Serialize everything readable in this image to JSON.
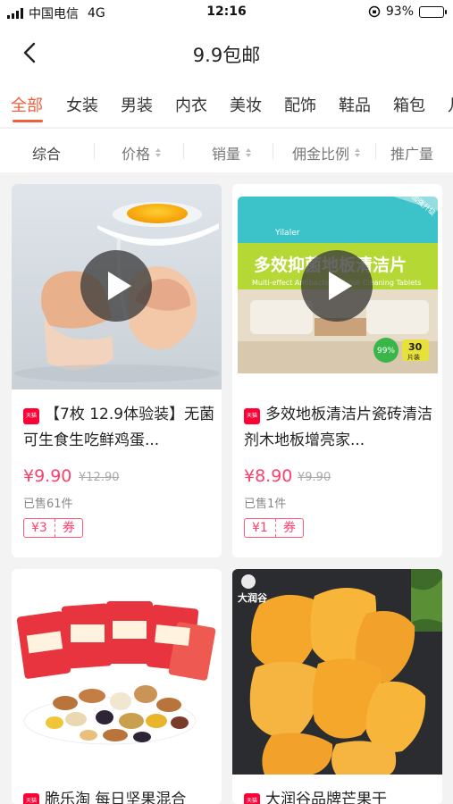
{
  "status_bar": {
    "carrier": "中国电信",
    "network": "4G",
    "time": "12:16",
    "battery": "93%",
    "battery_level": 0.93
  },
  "nav": {
    "title": "9.9包邮",
    "back_icon": "chevron-left-icon"
  },
  "tabs": [
    {
      "label": "全部",
      "active": true
    },
    {
      "label": "女装"
    },
    {
      "label": "男装"
    },
    {
      "label": "内衣"
    },
    {
      "label": "美妆"
    },
    {
      "label": "配饰"
    },
    {
      "label": "鞋品"
    },
    {
      "label": "箱包"
    },
    {
      "label": "儿"
    }
  ],
  "sort": [
    {
      "label": "综合"
    },
    {
      "label": "价格"
    },
    {
      "label": "销量"
    },
    {
      "label": "佣金比例"
    },
    {
      "label": "推广量"
    }
  ],
  "products": [
    {
      "name": "【7枚 12.9体验装】无菌可生食生吃鲜鸡蛋...",
      "price": "¥9.90",
      "original_price": "¥12.90",
      "sold": "已售61件",
      "coupon_amount": "¥3",
      "coupon_label": "券",
      "shop_badge": "天猫",
      "has_video": true
    },
    {
      "name": "多效地板清洁片瓷砖清洁剂木地板增亮家...",
      "price": "¥8.90",
      "original_price": "¥9.90",
      "sold": "已售1件",
      "coupon_amount": "¥1",
      "coupon_label": "券",
      "shop_badge": "天猫",
      "has_video": true,
      "image_text": {
        "brand": "Yilaler",
        "headline": "多效抑菌地板清洁片",
        "sub": "Multi-effect Antibacterial Floor Cleaning Tablets",
        "corner": "加强升级",
        "badge_pct": "99%",
        "badge_count": "30",
        "badge_unit": "片装"
      }
    },
    {
      "name": "脆乐淘 每日坚果混合",
      "shop_badge": "天猫"
    },
    {
      "name": "大润谷品牌芒果干",
      "shop_badge": "天猫",
      "image_text": {
        "brand": "大润谷"
      }
    }
  ]
}
